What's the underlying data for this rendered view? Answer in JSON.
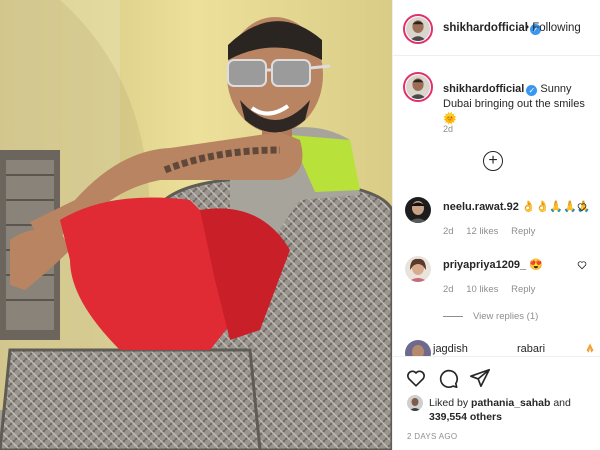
{
  "post": {
    "photo_alt": "",
    "header": {
      "username": "shikhardofficial",
      "verified": true,
      "separator": "•",
      "follow_label": "Following"
    },
    "caption": {
      "username": "shikhardofficial",
      "text": "Sunny Dubai bringing out the smiles 🌞",
      "time": "2d"
    },
    "load_more_label": "+",
    "comments": [
      {
        "username": "neelu.rawat.92",
        "text": "👌👌🙏🙏🙏",
        "time": "2d",
        "likes": "12 likes",
        "reply_label": "Reply"
      },
      {
        "username": "priyapriya1209_",
        "text": "😍",
        "time": "2d",
        "likes": "10 likes",
        "reply_label": "Reply"
      }
    ],
    "view_replies_label": "View replies (1)",
    "partial_comment": {
      "username": "jagdish",
      "text": "rabari"
    },
    "actions": {
      "like_icon": "heart-icon",
      "comment_icon": "comment-icon",
      "share_icon": "share-icon"
    },
    "liked_by": {
      "prefix": "Liked by",
      "username": "pathania_sahab",
      "joiner": "and",
      "count": "339,554 others"
    },
    "date": "2 DAYS AGO"
  },
  "colors": {
    "verified": "#3897f0",
    "story_ring": "#e1306c",
    "muted": "#8e8e8e",
    "text": "#262626"
  }
}
